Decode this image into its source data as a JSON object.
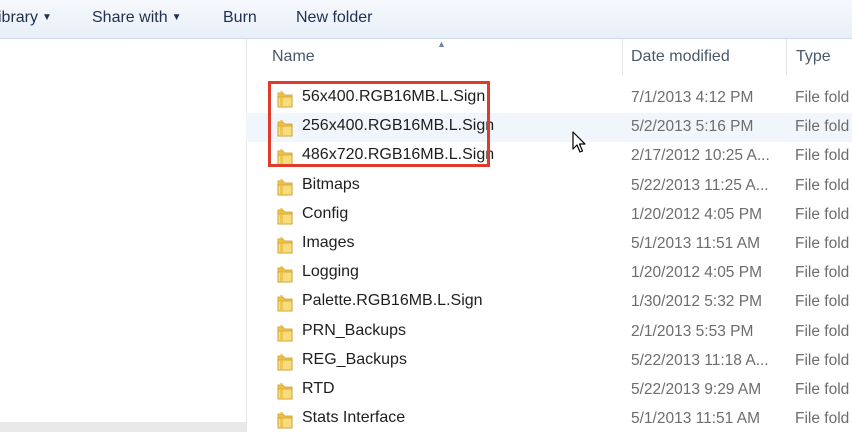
{
  "toolbar": {
    "library_label": "ibrary",
    "share_label": "Share with",
    "burn_label": "Burn",
    "new_folder_label": "New folder"
  },
  "columns": {
    "name": "Name",
    "date": "Date modified",
    "type": "Type"
  },
  "rows": [
    {
      "name": "56x400.RGB16MB.L.Sign",
      "date": "7/1/2013 4:12 PM",
      "type": "File fold"
    },
    {
      "name": "256x400.RGB16MB.L.Sign",
      "date": "5/2/2013 5:16 PM",
      "type": "File fold"
    },
    {
      "name": "486x720.RGB16MB.L.Sign",
      "date": "2/17/2012 10:25 A...",
      "type": "File fold"
    },
    {
      "name": "Bitmaps",
      "date": "5/22/2013 11:25 A...",
      "type": "File fold"
    },
    {
      "name": "Config",
      "date": "1/20/2012 4:05 PM",
      "type": "File fold"
    },
    {
      "name": "Images",
      "date": "5/1/2013 11:51 AM",
      "type": "File fold"
    },
    {
      "name": "Logging",
      "date": "1/20/2012 4:05 PM",
      "type": "File fold"
    },
    {
      "name": "Palette.RGB16MB.L.Sign",
      "date": "1/30/2012 5:32 PM",
      "type": "File fold"
    },
    {
      "name": "PRN_Backups",
      "date": "2/1/2013 5:53 PM",
      "type": "File fold"
    },
    {
      "name": "REG_Backups",
      "date": "5/22/2013 11:18 A...",
      "type": "File fold"
    },
    {
      "name": "RTD",
      "date": "5/22/2013 9:29 AM",
      "type": "File fold"
    },
    {
      "name": "Stats Interface",
      "date": "5/1/2013 11:51 AM",
      "type": "File fold"
    }
  ],
  "colors": {
    "highlight": "#e03a2a",
    "folder": "#f2c84b"
  },
  "icons": {
    "folder": "folder-icon",
    "cursor": "mouse-cursor-icon"
  }
}
